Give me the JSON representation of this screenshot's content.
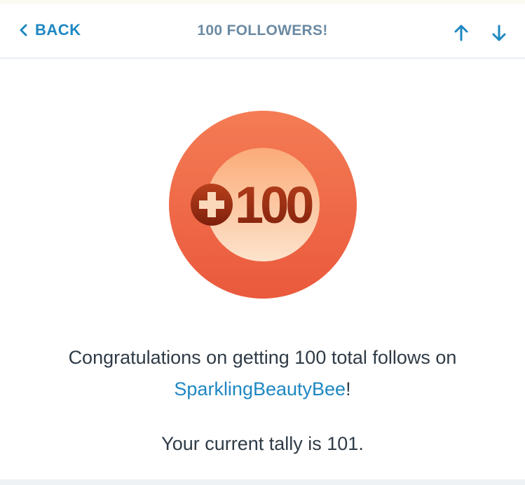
{
  "header": {
    "back_label": "BACK",
    "title": "100 FOLLOWERS!",
    "icons": {
      "back": "chevron-left-icon",
      "prev": "arrow-up-icon",
      "next": "arrow-down-icon"
    }
  },
  "badge": {
    "text": "100",
    "icon": "plus-circle-icon",
    "colors": {
      "outer_top": "#f47a55",
      "outer_bottom": "#ea5a3c",
      "inner_top": "#fbb07c",
      "inner_bottom": "#fde0c7",
      "text": "#9a2d14"
    }
  },
  "message": {
    "line1": "Congratulations on getting 100 total follows on",
    "site_link": "SparklingBeautyBee",
    "line2_suffix": "!",
    "tally": "Your current tally is 101."
  },
  "colors": {
    "accent": "#1e87c2",
    "title": "#6b8aa3",
    "body_text": "#2f3b46"
  }
}
